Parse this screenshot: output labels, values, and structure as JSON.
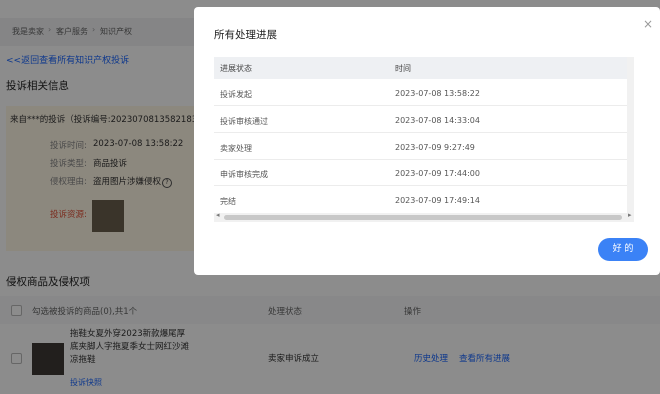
{
  "breadcrumb": [
    "我是卖家",
    "客户服务",
    "知识产权"
  ],
  "back_link": "<<返回查看所有知识产权投诉",
  "complaint_section_title": "投诉相关信息",
  "complainant": "来自***的投诉（投诉编号:2023070813582183",
  "fields": {
    "time_label": "投诉时间:",
    "time_value": "2023-07-08 13:58:22",
    "type_label": "投诉类型:",
    "type_value": "商品投诉",
    "reason_label": "侵权理由:",
    "reason_value": "盗用图片涉嫌侵权",
    "evidence_label": "投诉资源:"
  },
  "items_section_title": "侵权商品及侵权项",
  "table": {
    "select_label": "勾选被投诉的商品(0),共1个",
    "status_header": "处理状态",
    "action_header": "操作",
    "row": {
      "title": "拖鞋女夏外穿2023新款爆尾厚底夹脚人字拖夏季女士网红沙滩凉拖鞋",
      "link": "投诉快照",
      "status": "卖家申诉成立",
      "action_history": "历史处理",
      "action_progress": "查看所有进展"
    }
  },
  "modal": {
    "title": "所有处理进展",
    "close_glyph": "×",
    "headers": [
      "进展状态",
      "时间"
    ],
    "rows": [
      {
        "status": "投诉发起",
        "time": "2023-07-08 13:58:22"
      },
      {
        "status": "投诉审核通过",
        "time": "2023-07-08 14:33:04"
      },
      {
        "status": "卖家处理",
        "time": "2023-07-09 9:27:49"
      },
      {
        "status": "申诉审核完成",
        "time": "2023-07-09 17:44:00"
      },
      {
        "status": "完结",
        "time": "2023-07-09 17:49:14"
      }
    ],
    "ok_button": "好 的"
  }
}
